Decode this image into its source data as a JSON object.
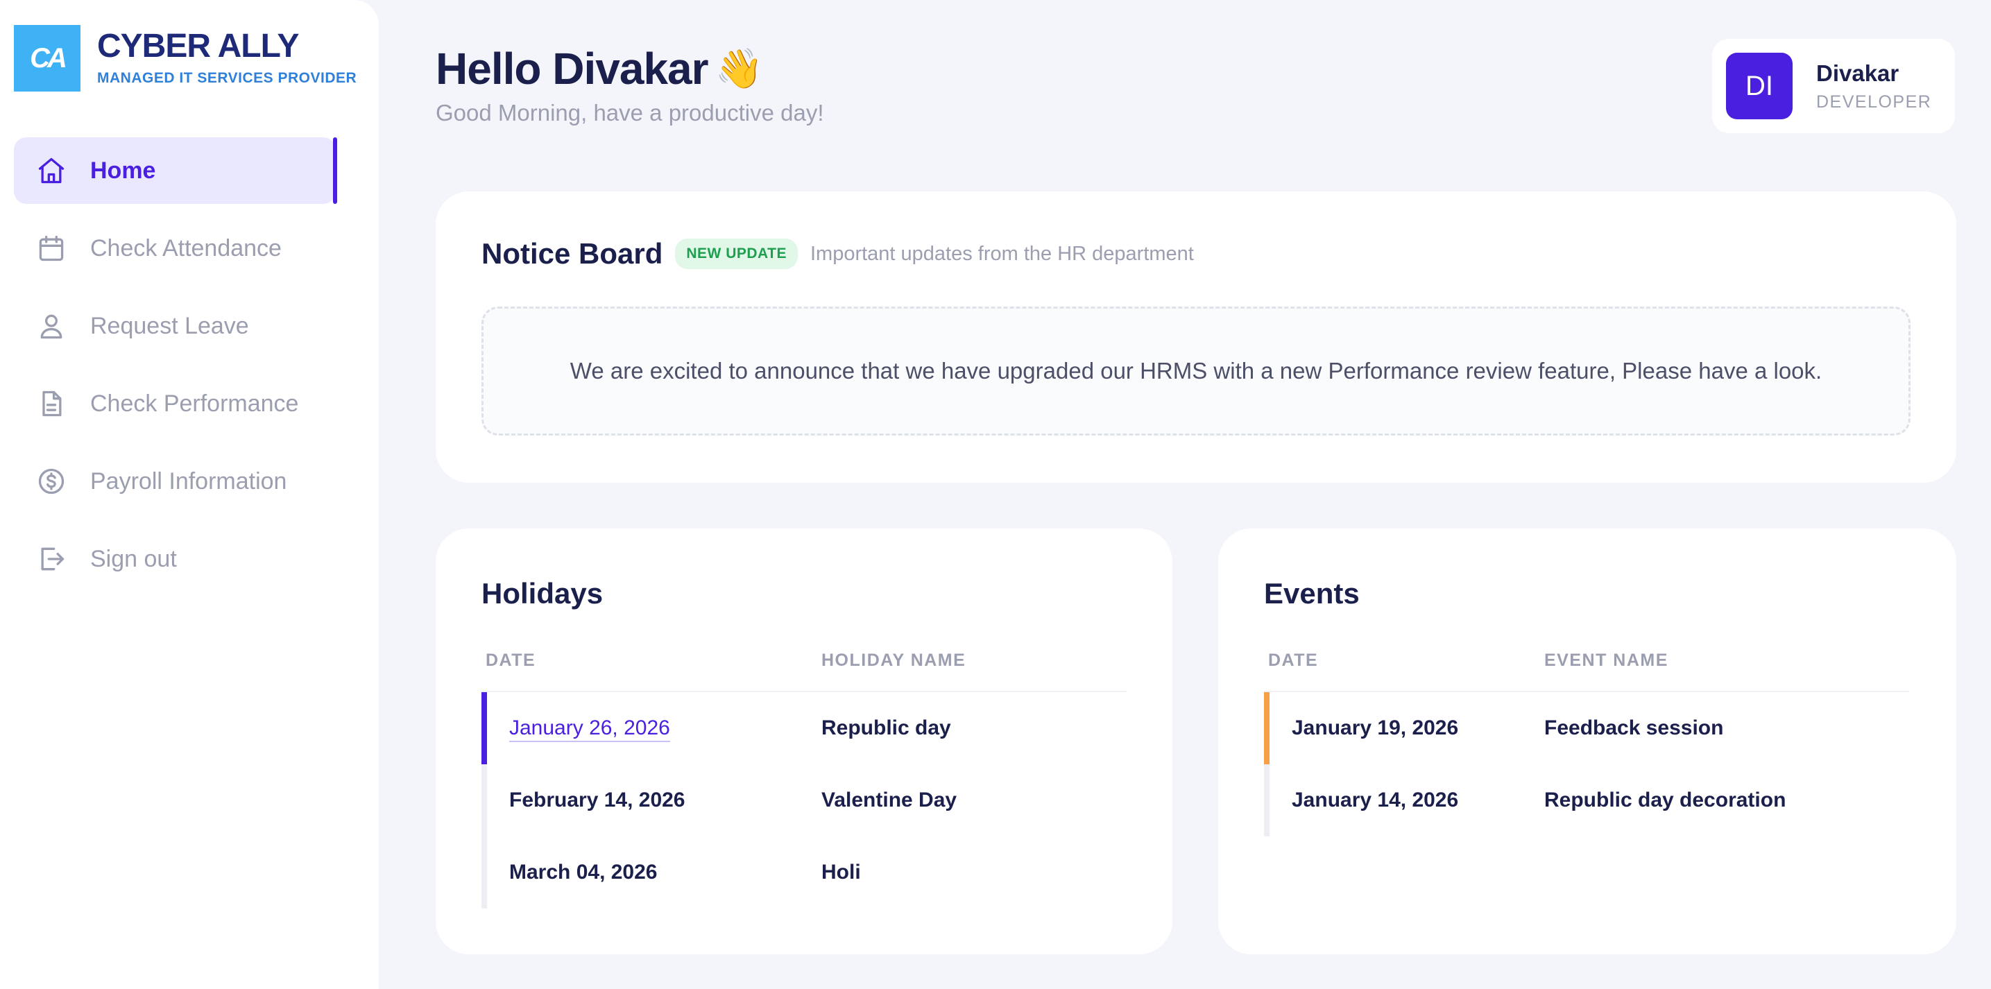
{
  "brand": {
    "logo_mark": "CA",
    "name": "CYBER ALLY",
    "tagline": "MANAGED IT SERVICES PROVIDER",
    "color": "#3fb1f5"
  },
  "sidebar": {
    "items": [
      {
        "label": "Home",
        "icon": "home-icon",
        "active": true
      },
      {
        "label": "Check Attendance",
        "icon": "calendar-icon",
        "active": false
      },
      {
        "label": "Request Leave",
        "icon": "user-icon",
        "active": false
      },
      {
        "label": "Check Performance",
        "icon": "document-icon",
        "active": false
      },
      {
        "label": "Payroll Information",
        "icon": "dollar-circle-icon",
        "active": false
      },
      {
        "label": "Sign out",
        "icon": "sign-out-icon",
        "active": false
      }
    ]
  },
  "header": {
    "greeting": "Hello Divakar",
    "wave": "👋",
    "subtitle": "Good Morning, have a productive day!"
  },
  "profile": {
    "initials": "DI",
    "name": "Divakar",
    "role": "DEVELOPER"
  },
  "notice": {
    "title": "Notice Board",
    "badge": "NEW UPDATE",
    "subtitle": "Important updates from the HR department",
    "message": "We are excited to announce that we have upgraded our HRMS with a new Performance review feature, Please have a look."
  },
  "holidays": {
    "title": "Holidays",
    "columns": [
      "DATE",
      "HOLIDAY NAME"
    ],
    "rows": [
      {
        "date": "January 26, 2026",
        "name": "Republic day"
      },
      {
        "date": "February 14, 2026",
        "name": "Valentine Day"
      },
      {
        "date": "March 04, 2026",
        "name": "Holi"
      }
    ]
  },
  "events": {
    "title": "Events",
    "columns": [
      "DATE",
      "EVENT NAME"
    ],
    "rows": [
      {
        "date": "January 19, 2026",
        "name": "Feedback session"
      },
      {
        "date": "January 14, 2026",
        "name": "Republic day decoration"
      }
    ]
  },
  "colors": {
    "accent": "#4a1fe0",
    "event_accent": "#f5a047",
    "badge_green": "#1e9e4f"
  }
}
